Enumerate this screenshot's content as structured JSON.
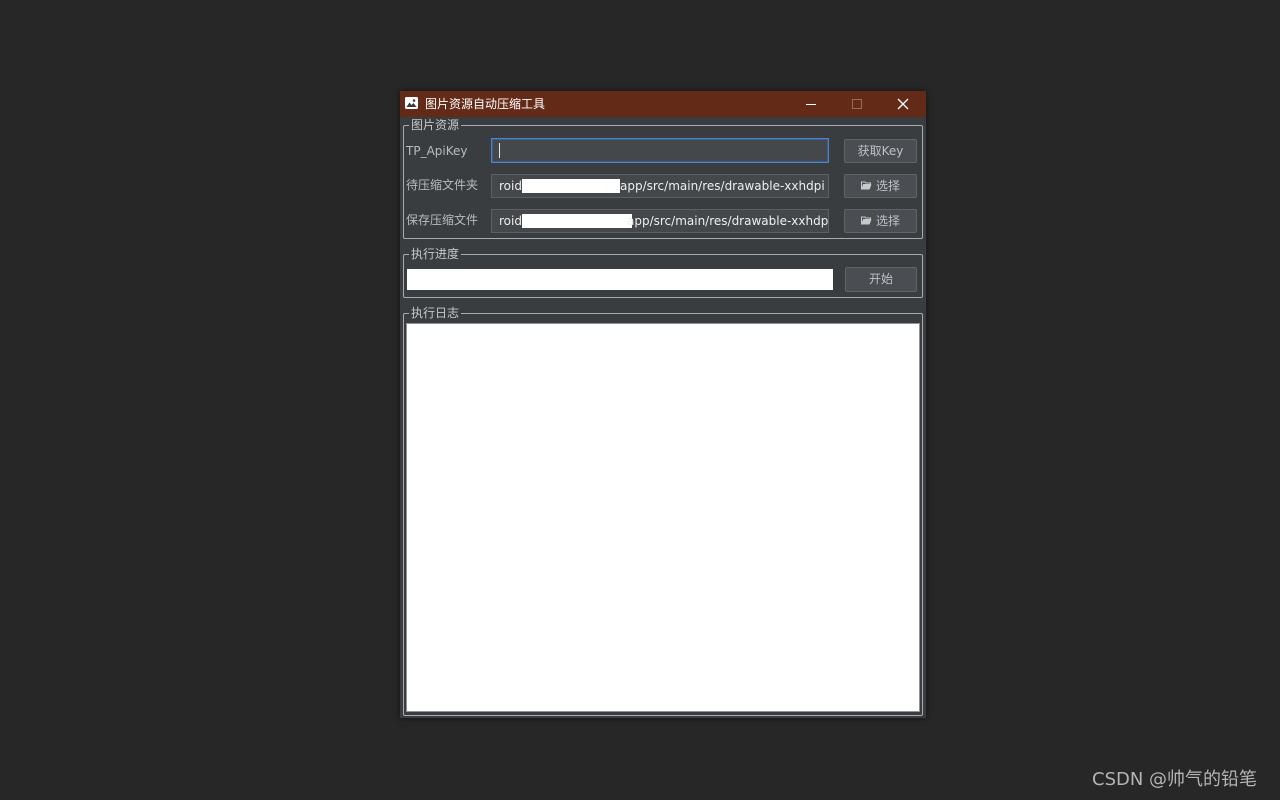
{
  "window": {
    "title": "图片资源自动压缩工具",
    "title_bar_color": "#642a18",
    "background_color": "#3a3d40",
    "icon": "image-icon"
  },
  "controls": {
    "minimize": "minimize-icon",
    "maximize": "maximize-icon",
    "close": "close-icon"
  },
  "image_source": {
    "group_title": "图片资源",
    "apikey_label": "TP_ApiKey",
    "apikey_value": "",
    "get_key_button": "获取Key",
    "source_folder_label": "待压缩文件夹",
    "source_folder_value_start": "roid",
    "source_folder_value_end": "app/src/main/res/drawable-xxhdpi",
    "save_folder_label": "保存压缩文件",
    "save_folder_value_start": "roid",
    "save_folder_value_end": "app/src/main/res/drawable-xxhdpi",
    "select_button": "选择",
    "select_icon": "folder-icon"
  },
  "progress": {
    "group_title": "执行进度",
    "value": 0,
    "start_button": "开始"
  },
  "log": {
    "group_title": "执行日志",
    "content": ""
  },
  "watermark": "CSDN @帅气的铅笔"
}
